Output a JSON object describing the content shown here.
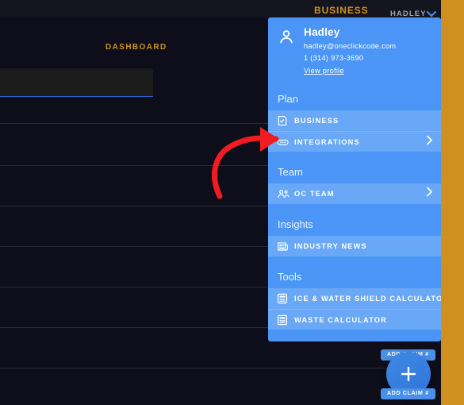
{
  "header": {
    "page_title": "BUSINESS",
    "user_name": "HADLEY",
    "close_icon": "chevron-collapse-icon"
  },
  "main": {
    "dashboard_label": "DASHBOARD",
    "search_value": "",
    "search_placeholder": ""
  },
  "fab": {
    "icon": "plus-icon",
    "claim_pill_top": "ADD CLAIM #",
    "claim_pill_bottom": "ADD CLAIM #"
  },
  "annotation": {
    "type": "curved-arrow",
    "color": "#f01c22",
    "points_to": "INTEGRATIONS"
  },
  "dropdown": {
    "profile": {
      "avatar_icon": "person-icon",
      "name": "Hadley",
      "email": "hadley@oneclickcode.com",
      "phone": "1 (314) 973-3690",
      "link": "View profile"
    },
    "sections": [
      {
        "title": "Plan",
        "items": [
          {
            "label": "BUSINESS",
            "icon": "document-check-icon",
            "chevron": false
          },
          {
            "label": "INTEGRATIONS",
            "icon": "integrations-icon",
            "chevron": true
          }
        ]
      },
      {
        "title": "Team",
        "items": [
          {
            "label": "OC TEAM",
            "icon": "people-group-icon",
            "chevron": true
          }
        ]
      },
      {
        "title": "Insights",
        "items": [
          {
            "label": "INDUSTRY NEWS",
            "icon": "newspaper-icon",
            "chevron": false
          }
        ]
      },
      {
        "title": "Tools",
        "items": [
          {
            "label": "ICE & WATER SHIELD CALCULATOR",
            "icon": "calculator-icon",
            "chevron": false
          },
          {
            "label": "WASTE CALCULATOR",
            "icon": "calculator-icon",
            "chevron": false
          }
        ]
      }
    ]
  },
  "colors": {
    "brand_orange": "#d2901f",
    "panel_blue": "#4a95f5",
    "item_blue": "#68a8f7",
    "app_dark": "#0e0e1a",
    "annotation_red": "#f01c22"
  }
}
